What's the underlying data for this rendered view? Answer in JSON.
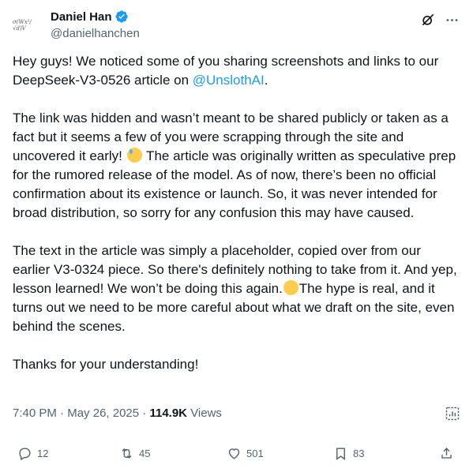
{
  "author": {
    "display_name": "Daniel Han",
    "handle": "@danielhanchen",
    "verified": true,
    "avatar_formula": "σ(Wx²/√d)V"
  },
  "tweet": {
    "paragraphs": [
      {
        "before": "Hey guys! We noticed some of you sharing screenshots and links to our DeepSeek-V3-0526 article on ",
        "mention": "@UnslothAI",
        "after": "."
      },
      {
        "before": "The link was hidden and wasn’t meant to be shared publicly or taken as a fact but it seems a few of you were scrapping through the site and uncovered it early! ",
        "after": " The article was originally written as speculative prep for the rumored release of the model. As of now, there’s been no official confirmation about its existence or launch. So, it was never intended for broad distribution, so sorry for any confusion this may have caused."
      },
      {
        "before": "The text in the article was simply a placeholder, copied over from our earlier V3-0324 piece. So there's definitely nothing to take from it. And yep, lesson learned! We won’t be doing this again.",
        "after": "The hype is real, and it turns out we need to be more careful about what we draft on the site, even behind the scenes."
      },
      {
        "text": "Thanks for your understanding!"
      }
    ]
  },
  "meta": {
    "time": "7:40 PM",
    "separator": " · ",
    "date": "May 26, 2025",
    "views_count": "114.9K",
    "views_label": "Views"
  },
  "actions": {
    "replies": "12",
    "reposts": "45",
    "likes": "501",
    "bookmarks": "83"
  },
  "colors": {
    "text": "#0f1419",
    "secondary": "#536471",
    "accent": "#1d9bf0"
  },
  "icons": [
    "verified-badge-icon",
    "grok-icon",
    "more-icon",
    "analytics-icon",
    "reply-icon",
    "retweet-icon",
    "like-icon",
    "bookmark-icon",
    "share-icon"
  ]
}
